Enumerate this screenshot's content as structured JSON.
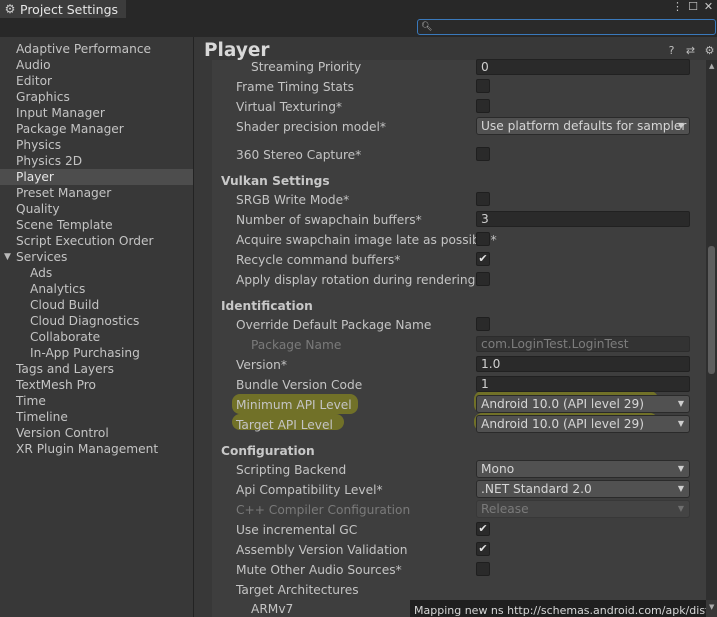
{
  "window": {
    "title": "Project Settings",
    "tab_icon": "gear-icon",
    "controls": [
      "more-icon",
      "maximize-icon",
      "close-icon"
    ]
  },
  "search": {
    "placeholder": "",
    "value": "",
    "icon": "search-icon"
  },
  "sidebar": {
    "items": [
      {
        "label": "Adaptive Performance",
        "indent": 0
      },
      {
        "label": "Audio",
        "indent": 0
      },
      {
        "label": "Editor",
        "indent": 0
      },
      {
        "label": "Graphics",
        "indent": 0
      },
      {
        "label": "Input Manager",
        "indent": 0
      },
      {
        "label": "Package Manager",
        "indent": 0
      },
      {
        "label": "Physics",
        "indent": 0
      },
      {
        "label": "Physics 2D",
        "indent": 0
      },
      {
        "label": "Player",
        "indent": 0,
        "selected": true
      },
      {
        "label": "Preset Manager",
        "indent": 0
      },
      {
        "label": "Quality",
        "indent": 0
      },
      {
        "label": "Scene Template",
        "indent": 0
      },
      {
        "label": "Script Execution Order",
        "indent": 0
      },
      {
        "label": "Services",
        "indent": 0,
        "expanded": true
      },
      {
        "label": "Ads",
        "indent": 1
      },
      {
        "label": "Analytics",
        "indent": 1
      },
      {
        "label": "Cloud Build",
        "indent": 1
      },
      {
        "label": "Cloud Diagnostics",
        "indent": 1
      },
      {
        "label": "Collaborate",
        "indent": 1
      },
      {
        "label": "In-App Purchasing",
        "indent": 1
      },
      {
        "label": "Tags and Layers",
        "indent": 0
      },
      {
        "label": "TextMesh Pro",
        "indent": 0
      },
      {
        "label": "Time",
        "indent": 0
      },
      {
        "label": "Timeline",
        "indent": 0
      },
      {
        "label": "Version Control",
        "indent": 0
      },
      {
        "label": "XR Plugin Management",
        "indent": 0
      }
    ]
  },
  "header": {
    "title": "Player",
    "icons": [
      "help-icon",
      "presets-icon",
      "settings-icon"
    ]
  },
  "rows": {
    "streaming_priority": {
      "label": "Streaming Priority",
      "value": "0"
    },
    "frame_timing": {
      "label": "Frame Timing Stats",
      "checked": false
    },
    "virtual_texturing": {
      "label": "Virtual Texturing*",
      "checked": false
    },
    "shader_precision": {
      "label": "Shader precision model*",
      "value": "Use platform defaults for sampler p"
    },
    "stereo_capture": {
      "label": "360 Stereo Capture*",
      "checked": false
    },
    "vulkan_header": "Vulkan Settings",
    "srgb_write": {
      "label": "SRGB Write Mode*",
      "checked": false
    },
    "swapchain_buffers": {
      "label": "Number of swapchain buffers*",
      "value": "3"
    },
    "acquire_swapchain": {
      "label": "Acquire swapchain image late as possible*",
      "checked": false
    },
    "recycle_buffers": {
      "label": "Recycle command buffers*",
      "checked": true
    },
    "display_rotation": {
      "label": "Apply display rotation during rendering",
      "checked": false
    },
    "identification_header": "Identification",
    "override_package": {
      "label": "Override Default Package Name",
      "checked": false
    },
    "package_name": {
      "label": "Package Name",
      "value": "com.LoginTest.LoginTest"
    },
    "version": {
      "label": "Version*",
      "value": "1.0"
    },
    "bundle_code": {
      "label": "Bundle Version Code",
      "value": "1"
    },
    "min_api": {
      "label": "Minimum API Level",
      "value": "Android 10.0 (API level 29)"
    },
    "target_api": {
      "label": "Target API Level",
      "value": "Android 10.0 (API level 29)"
    },
    "configuration_header": "Configuration",
    "scripting_backend": {
      "label": "Scripting Backend",
      "value": "Mono"
    },
    "api_compat": {
      "label": "Api Compatibility Level*",
      "value": ".NET Standard 2.0"
    },
    "cpp_config": {
      "label": "C++ Compiler Configuration",
      "value": "Release"
    },
    "incremental_gc": {
      "label": "Use incremental GC",
      "checked": true
    },
    "assembly_validation": {
      "label": "Assembly Version Validation",
      "checked": true
    },
    "mute_audio": {
      "label": "Mute Other Audio Sources*",
      "checked": false
    },
    "target_arch": {
      "label": "Target Architectures"
    },
    "armv7": {
      "label": "ARMv7",
      "checked": true
    }
  },
  "overlay": {
    "text": "Mapping new ns http://schemas.android.com/apk/distribution"
  },
  "colors": {
    "highlight": "#d6d600",
    "selection": "#4d4d4d",
    "focus": "#3a79bb"
  }
}
